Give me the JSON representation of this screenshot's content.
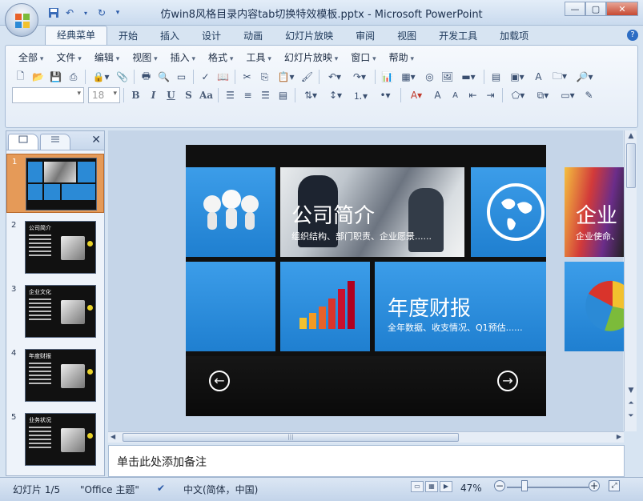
{
  "window": {
    "title": "仿win8风格目录内容tab切换特效模板.pptx - Microsoft PowerPoint",
    "minimize": "—",
    "maximize": "▢",
    "close": "✕"
  },
  "quick_access": [
    "save-icon",
    "undo-icon",
    "redo-icon",
    "customize-icon"
  ],
  "ribbon_tabs": [
    "经典菜单",
    "开始",
    "插入",
    "设计",
    "动画",
    "幻灯片放映",
    "审阅",
    "视图",
    "开发工具",
    "加载项"
  ],
  "active_tab": "经典菜单",
  "classic_menu": [
    "全部",
    "文件",
    "编辑",
    "视图",
    "插入",
    "格式",
    "工具",
    "幻灯片放映",
    "窗口",
    "帮助"
  ],
  "format_bar": {
    "font_name": "",
    "font_size": "18",
    "bold": "B",
    "italic": "I",
    "underline": "U",
    "strike": "S",
    "case": "Aa"
  },
  "pane": {
    "tab_slides": "slides-tab",
    "tab_outline": "outline-tab",
    "close": "✕"
  },
  "thumbnails": [
    {
      "number": "1",
      "title": "",
      "selected": true
    },
    {
      "number": "2",
      "title": "公司简介",
      "selected": false
    },
    {
      "number": "3",
      "title": "企业文化",
      "selected": false
    },
    {
      "number": "4",
      "title": "年度财报",
      "selected": false
    },
    {
      "number": "5",
      "title": "业务状况",
      "selected": false
    }
  ],
  "slide": {
    "tile1_title": "公司简介",
    "tile1_sub": "组织结构、部门职责、企业愿景......",
    "tile2_title": "年度财报",
    "tile2_sub": "全年数据、收支情况、Q1预估......",
    "tile3_title": "企业",
    "tile3_sub": "企业使命、",
    "prev": "←",
    "next": "→"
  },
  "notes_placeholder": "单击此处添加备注",
  "status": {
    "slide_count": "幻灯片 1/5",
    "theme": "\"Office 主题\"",
    "language": "中文(简体，中国)",
    "zoom": "47%",
    "zoom_out": "−",
    "zoom_in": "+"
  },
  "colors": {
    "tile_blue": "#2b8ad6",
    "selected_thumb": "#e59a58"
  }
}
